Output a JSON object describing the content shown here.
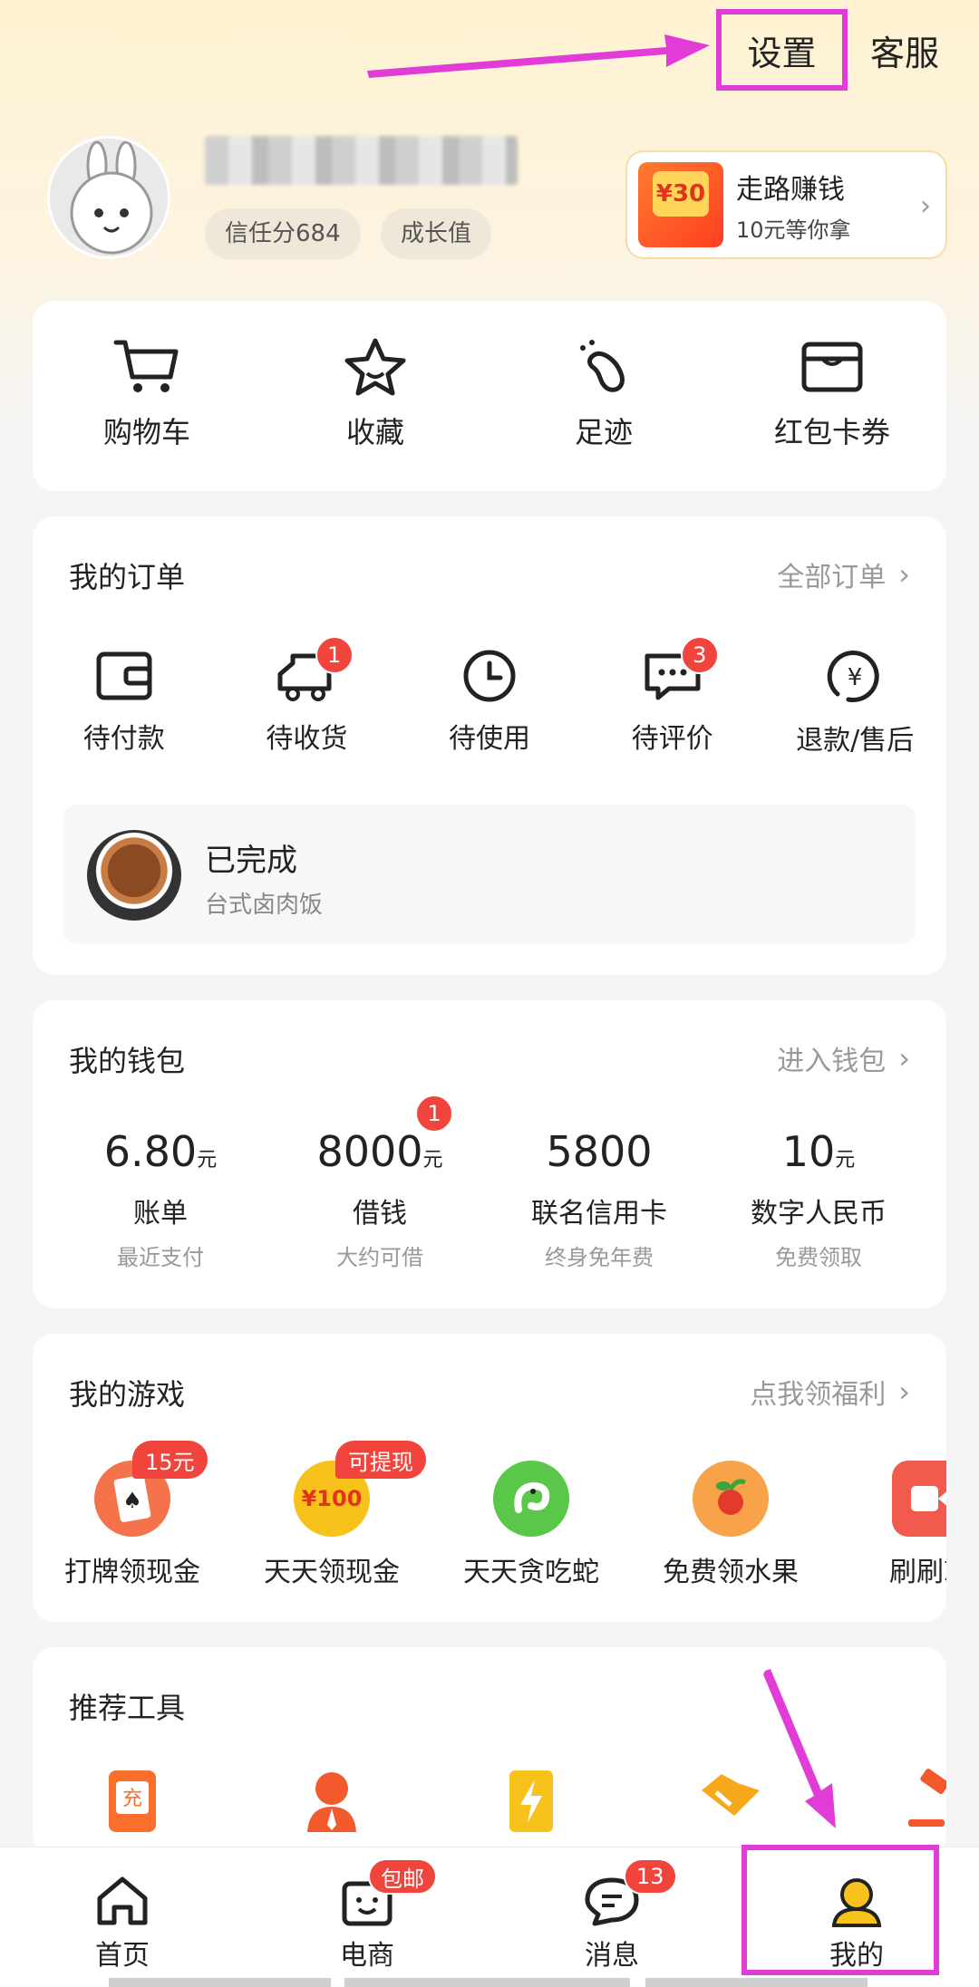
{
  "topbar": {
    "settings": "设置",
    "service": "客服"
  },
  "profile": {
    "trust": "信任分684",
    "growth": "成长值",
    "promo": {
      "title": "走路赚钱",
      "subtitle": "10元等你拿",
      "badge": "¥30"
    }
  },
  "quick": [
    {
      "label": "购物车",
      "icon": "cart-icon"
    },
    {
      "label": "收藏",
      "icon": "star-icon"
    },
    {
      "label": "足迹",
      "icon": "footprint-icon"
    },
    {
      "label": "红包卡券",
      "icon": "wallet-card-icon"
    }
  ],
  "orders": {
    "title": "我的订单",
    "link": "全部订单",
    "items": [
      {
        "label": "待付款",
        "icon": "wallet-icon",
        "badge": ""
      },
      {
        "label": "待收货",
        "icon": "truck-icon",
        "badge": "1"
      },
      {
        "label": "待使用",
        "icon": "clock-icon",
        "badge": ""
      },
      {
        "label": "待评价",
        "icon": "chat-icon",
        "badge": "3"
      },
      {
        "label": "退款/售后",
        "icon": "refund-icon",
        "badge": ""
      }
    ],
    "done": {
      "title": "已完成",
      "subtitle": "台式卤肉饭"
    }
  },
  "wallet": {
    "title": "我的钱包",
    "link": "进入钱包",
    "items": [
      {
        "value": "6.80",
        "unit": "元",
        "label": "账单",
        "sub": "最近支付",
        "badge": ""
      },
      {
        "value": "8000",
        "unit": "元",
        "label": "借钱",
        "sub": "大约可借",
        "badge": "1"
      },
      {
        "value": "5800",
        "unit": "",
        "label": "联名信用卡",
        "sub": "终身免年费",
        "badge": ""
      },
      {
        "value": "10",
        "unit": "元",
        "label": "数字人民币",
        "sub": "免费领取",
        "badge": ""
      }
    ]
  },
  "games": {
    "title": "我的游戏",
    "link": "点我领福利",
    "items": [
      {
        "label": "打牌领现金",
        "badge": "15元",
        "icon": "cards-icon",
        "color": "#f5734a"
      },
      {
        "label": "天天领现金",
        "badge": "可提现",
        "icon": "coin-icon",
        "color": "#f7c21b",
        "text": "¥100"
      },
      {
        "label": "天天贪吃蛇",
        "badge": "",
        "icon": "snake-icon",
        "color": "#5ac74a"
      },
      {
        "label": "免费领水果",
        "badge": "",
        "icon": "fruit-icon",
        "color": "#f8a24a"
      },
      {
        "label": "刷刷就",
        "badge": "",
        "icon": "video-icon",
        "color": "#f25a4e"
      }
    ]
  },
  "tools": {
    "title": "推荐工具"
  },
  "tabbar": [
    {
      "label": "首页",
      "icon": "home-icon",
      "badge": ""
    },
    {
      "label": "电商",
      "icon": "shop-bag-icon",
      "badge": "包邮"
    },
    {
      "label": "消息",
      "icon": "message-icon",
      "badge": "13"
    },
    {
      "label": "我的",
      "icon": "profile-icon",
      "badge": ""
    }
  ]
}
